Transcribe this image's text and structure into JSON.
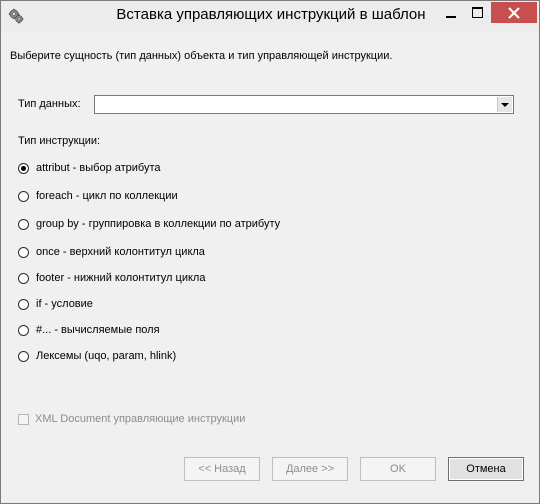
{
  "window": {
    "title": "Вставка управляющих инструкций в шаблон",
    "colors": {
      "close_button": "#c7504e",
      "dialog_bg": "#f0f0f0"
    },
    "icons": {
      "app": "gears-icon",
      "minimize": "minimize-icon",
      "maximize": "maximize-icon",
      "close": "close-icon"
    }
  },
  "dialog": {
    "intro": "Выберите сущность (тип данных) объекта и тип управляющей инструкции.",
    "data_type": {
      "label": "Тип данных:",
      "value": ""
    },
    "instruction_label": "Тип инструкции:",
    "options": [
      {
        "label": "attribut - выбор атрибута",
        "checked": true
      },
      {
        "label": "foreach - цикл по коллекции",
        "checked": false
      },
      {
        "label": "group by - группировка в коллекции по атрибуту",
        "checked": false
      },
      {
        "label": "once - верхний колонтитул цикла",
        "checked": false
      },
      {
        "label": "footer - нижний колонтитул цикла",
        "checked": false
      },
      {
        "label": "if - условие",
        "checked": false
      },
      {
        "label": "#... - вычисляемые поля",
        "checked": false
      },
      {
        "label": "Лексемы (uqo, param, hlink)",
        "checked": false
      }
    ],
    "xml_checkbox": {
      "label": "XML Document управляющие инструкции",
      "checked": false,
      "enabled": false
    }
  },
  "buttons": {
    "back": "<< Назад",
    "next": "Далее >>",
    "ok": "OK",
    "cancel": "Отмена"
  }
}
